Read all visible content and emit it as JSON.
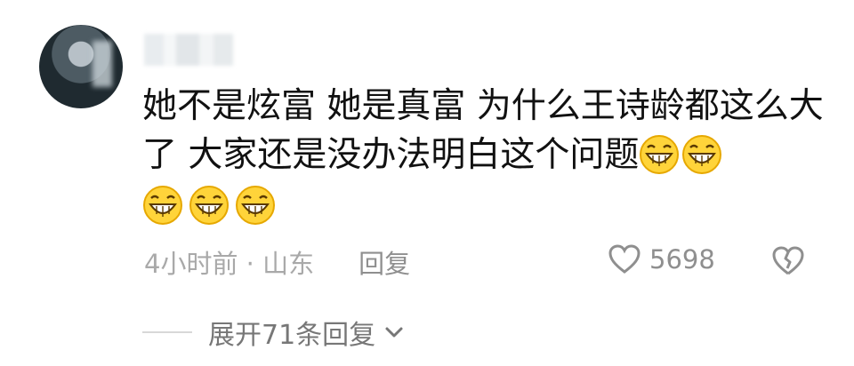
{
  "comment": {
    "text": "她不是炫富 她是真富  为什么王诗龄都这么大了  大家还是没办法明白这个问题",
    "emojis": [
      "grin-emoji",
      "grin-emoji",
      "grin-emoji",
      "grin-emoji",
      "grin-emoji"
    ]
  },
  "meta": {
    "time_location": "4小时前 · 山东",
    "reply_label": "回复"
  },
  "likes": {
    "count": "5698",
    "icon": "heart-outline-icon",
    "dislike_icon": "broken-heart-icon"
  },
  "replies": {
    "expand_label": "展开71条回复",
    "icon": "chevron-down-icon"
  },
  "colors": {
    "text": "#111111",
    "meta": "#a9a9a9",
    "icon": "#8f8f8f",
    "emoji_face": "#ffd43a"
  }
}
